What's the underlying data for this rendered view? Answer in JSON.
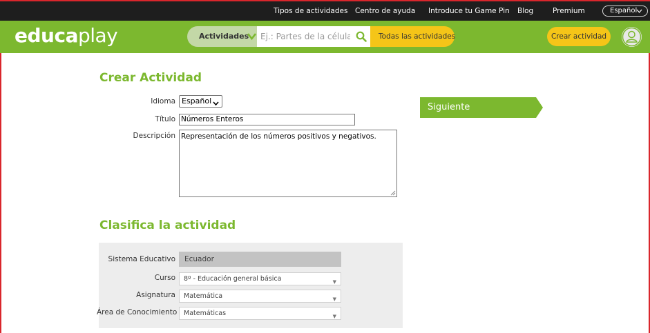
{
  "topbar": {
    "links": [
      "Tipos de actividades",
      "Centro de ayuda",
      "Introduce tu Game Pin",
      "Blog",
      "Premium"
    ],
    "language": "Español"
  },
  "header": {
    "logo_part1": "educa",
    "logo_part2": "play",
    "activities_label": "Actividades",
    "search_placeholder": "Ej.: Partes de la célula..",
    "all_activities_label": "Todas las actividades",
    "create_label": "Crear actividad"
  },
  "form": {
    "title": "Crear Actividad",
    "language_label": "Idioma",
    "language_value": "Español",
    "title_label": "Título",
    "title_value": "Números Enteros",
    "description_label": "Descripción",
    "description_value": "Representación de los números positivos y negativos.",
    "next_label": "Siguiente"
  },
  "classify": {
    "title": "Clasifica la actividad",
    "system_label": "Sistema Educativo",
    "system_value": "Ecuador",
    "course_label": "Curso",
    "course_value": "8º - Educación general básica",
    "subject_label": "Asignatura",
    "subject_value": "Matemática",
    "area_label": "Área de Conocimiento",
    "area_value": "Matemáticas"
  },
  "colors": {
    "brand_green": "#7cb82f",
    "accent_yellow": "#f5c518",
    "frame_red": "#d9262c"
  }
}
